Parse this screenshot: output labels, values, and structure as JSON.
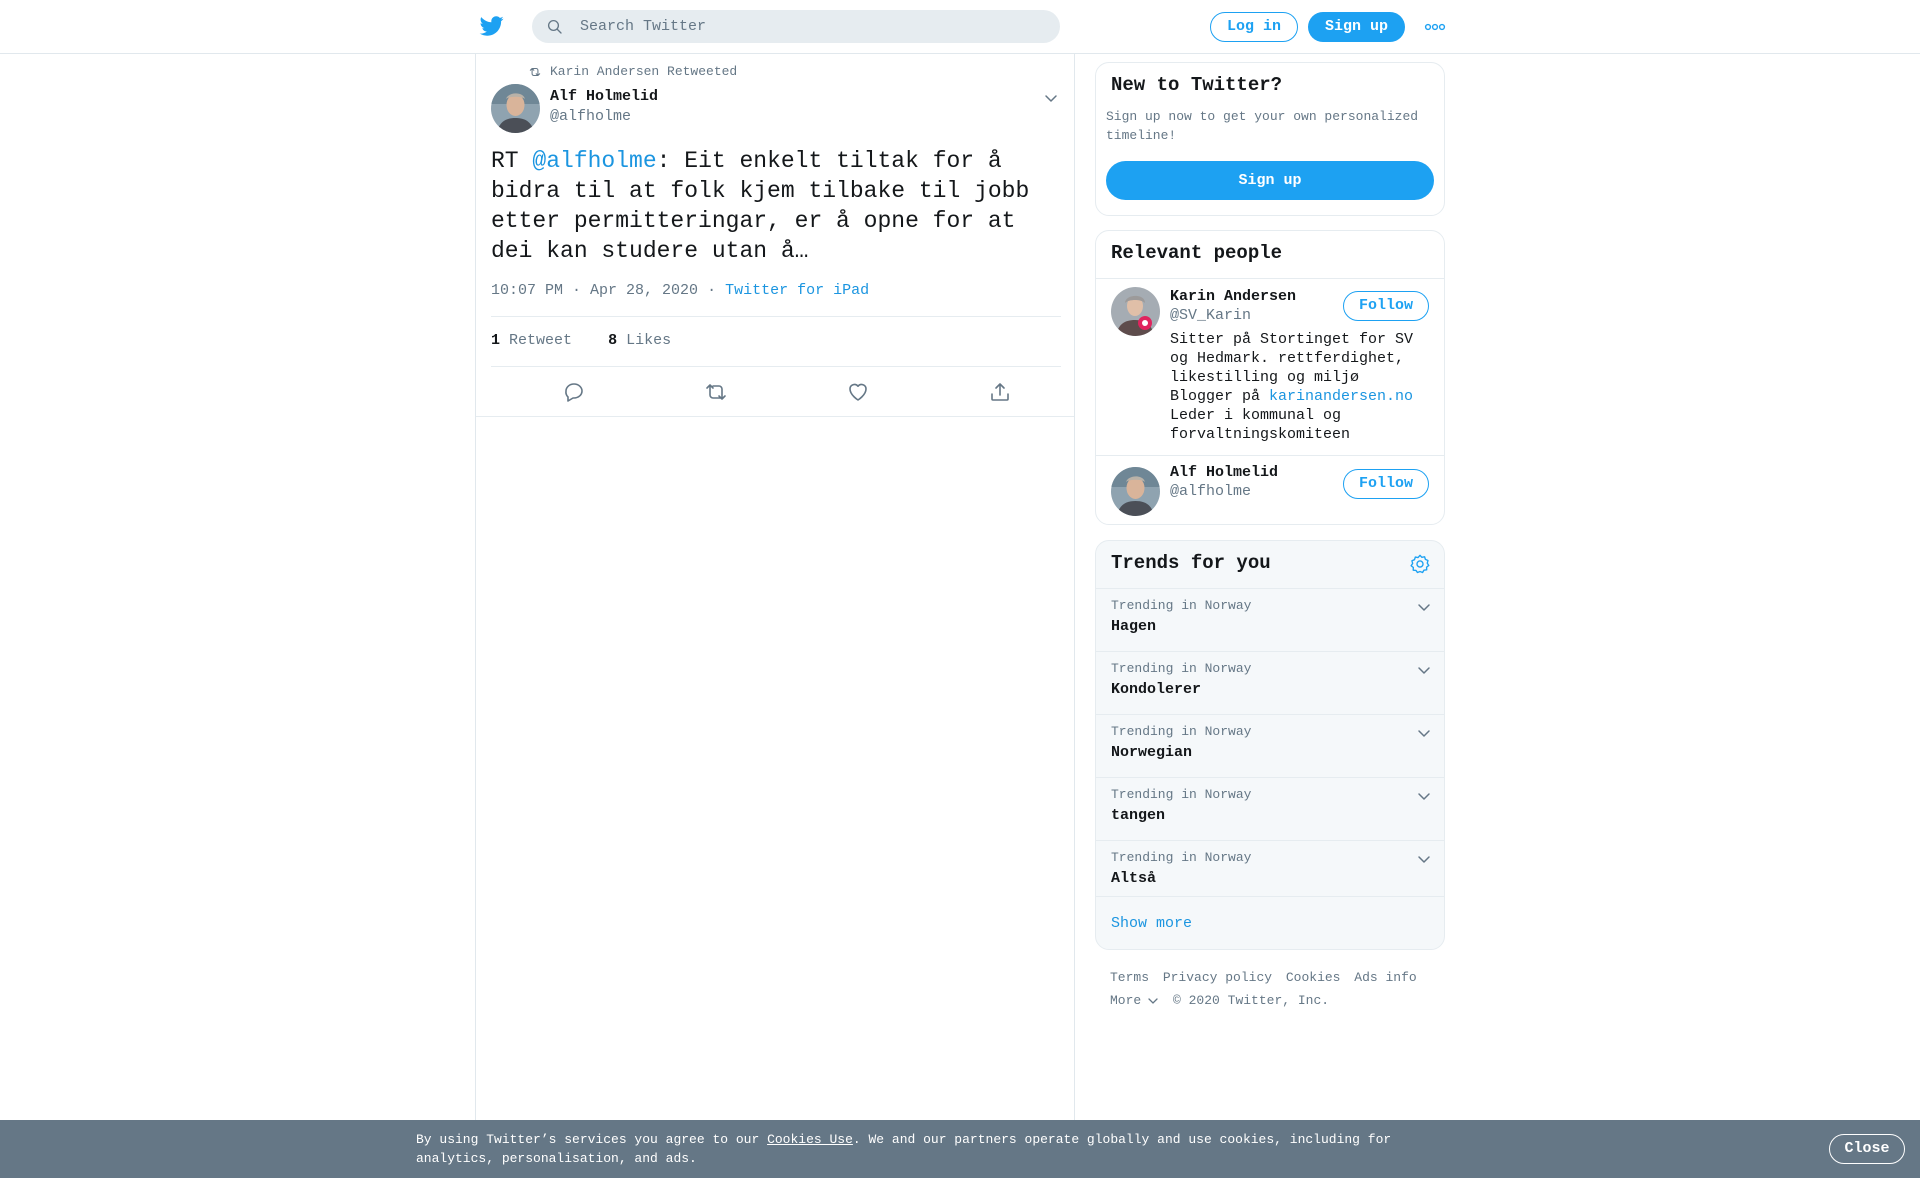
{
  "header": {
    "search_placeholder": "Search Twitter",
    "login_label": "Log in",
    "signup_label": "Sign up",
    "logo_icon": "twitter-bird-icon",
    "more_icon": "more-dots-icon",
    "accent": "#1da1f2"
  },
  "tweet": {
    "retweeted_by": "Karin Andersen Retweeted",
    "author_name": "Alf Holmelid",
    "author_handle": "@alfholme",
    "text_prefix": "RT ",
    "text_mention": "@alfholme",
    "text_body": ": Eit enkelt tiltak for å bidra til at folk kjem tilbake til jobb etter permitteringar, er å opne for at dei kan studere utan å…",
    "time": "10:07 PM · Apr 28, 2020",
    "separator": "·",
    "source": "Twitter for iPad",
    "retweet_count": "1",
    "retweet_label": "Retweet",
    "like_count": "8",
    "like_label": "Likes"
  },
  "new_to_twitter": {
    "title": "New to Twitter?",
    "description": "Sign up now to get your own personalized timeline!",
    "signup_label": "Sign up"
  },
  "relevant_people": {
    "title": "Relevant people",
    "people": [
      {
        "name": "Karin Andersen",
        "handle": "@SV_Karin",
        "follow_label": "Follow",
        "bio_line1": "Sitter på Stortinget for SV og Hedmark. rettferdighet, likestilling og miljø",
        "bio_blogger": "Blogger på ",
        "bio_link": "karinandersen.no",
        "bio_line3": "Leder i kommunal og forvaltningskomiteen"
      },
      {
        "name": "Alf Holmelid",
        "handle": "@alfholme",
        "follow_label": "Follow"
      }
    ]
  },
  "trends": {
    "title": "Trends for you",
    "items": [
      {
        "context": "Trending in Norway",
        "name": "Hagen"
      },
      {
        "context": "Trending in Norway",
        "name": "Kondolerer"
      },
      {
        "context": "Trending in Norway",
        "name": "Norwegian"
      },
      {
        "context": "Trending in Norway",
        "name": "tangen"
      },
      {
        "context": "Trending in Norway",
        "name": "Altså"
      }
    ],
    "show_more": "Show more"
  },
  "footer": {
    "links": [
      "Terms",
      "Privacy policy",
      "Cookies",
      "Ads info"
    ],
    "more": "More",
    "copyright": "© 2020 Twitter, Inc."
  },
  "cookie_banner": {
    "text_before": "By using Twitter’s services you agree to our ",
    "link": "Cookies Use",
    "text_after": ". We and our partners operate globally and use cookies, including for analytics, personalisation, and ads.",
    "close_label": "Close"
  }
}
